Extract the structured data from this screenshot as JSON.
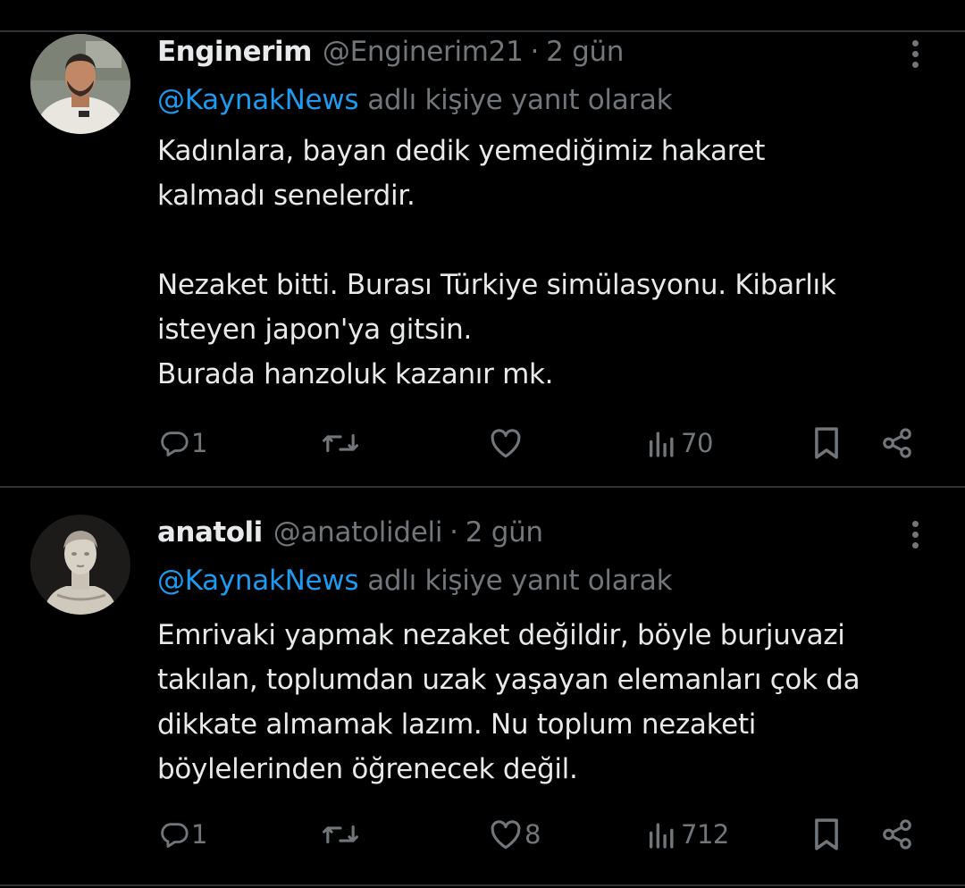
{
  "tweets": [
    {
      "display_name": "Enginerim",
      "handle": "@Enginerim21",
      "separator": "·",
      "time": "2 gün",
      "reply_mention": "@KaynakNews",
      "reply_suffix": "adlı kişiye yanıt olarak",
      "body_lines": [
        "Kadınlara, bayan dedik yemediğimiz hakaret",
        "kalmadı senelerdir.",
        "",
        "Nezaket bitti. Burası Türkiye simülasyonu. Kibarlık",
        "isteyen japon'ya gitsin.",
        "Burada hanzoluk kazanır mk."
      ],
      "stats": {
        "replies": "1",
        "retweets": "",
        "likes": "",
        "views": "70"
      },
      "avatar": "man-photo"
    },
    {
      "display_name": "anatoli",
      "handle": "@anatolideli",
      "separator": "·",
      "time": "2 gün",
      "reply_mention": "@KaynakNews",
      "reply_suffix": "adlı kişiye yanıt olarak",
      "body_lines": [
        "Emrivaki yapmak nezaket değildir, böyle burjuvazi",
        "takılan, toplumdan uzak yaşayan elemanları çok da",
        "dikkate almamak lazım. Nu toplum nezaketi",
        "böylelerinden öğrenecek değil."
      ],
      "stats": {
        "replies": "1",
        "retweets": "",
        "likes": "8",
        "views": "712"
      },
      "avatar": "marble-bust"
    }
  ],
  "icons": {
    "reply": "speech-bubble-icon",
    "retweet": "retweet-icon",
    "like": "heart-icon",
    "views": "bar-chart-icon",
    "bookmark": "bookmark-icon",
    "share": "share-icon",
    "more": "more-vertical-icon"
  },
  "colors": {
    "background": "#000000",
    "text": "#e7e9ea",
    "muted": "#71767b",
    "accent": "#1d9bf0",
    "divider": "#2f3336"
  }
}
